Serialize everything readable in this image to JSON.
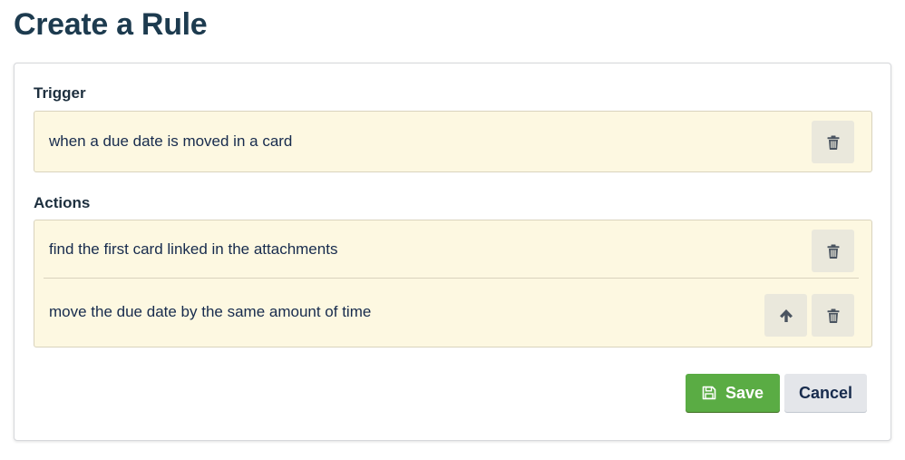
{
  "page": {
    "title": "Create a Rule"
  },
  "trigger": {
    "label": "Trigger",
    "items": [
      {
        "text": "when a due date is moved in a card"
      }
    ]
  },
  "actions": {
    "label": "Actions",
    "items": [
      {
        "text": "find the first card linked in the attachments"
      },
      {
        "text": "move the due date by the same amount of time"
      }
    ]
  },
  "footer": {
    "save_label": "Save",
    "cancel_label": "Cancel"
  },
  "icons": {
    "delete": "trash-icon",
    "move_up": "arrow-up-icon",
    "save": "floppy-disk-icon"
  },
  "colors": {
    "title": "#1d3b4f",
    "row_background": "#fdf8e1",
    "save_button": "#5aac44",
    "cancel_button": "#e4e6ea"
  }
}
